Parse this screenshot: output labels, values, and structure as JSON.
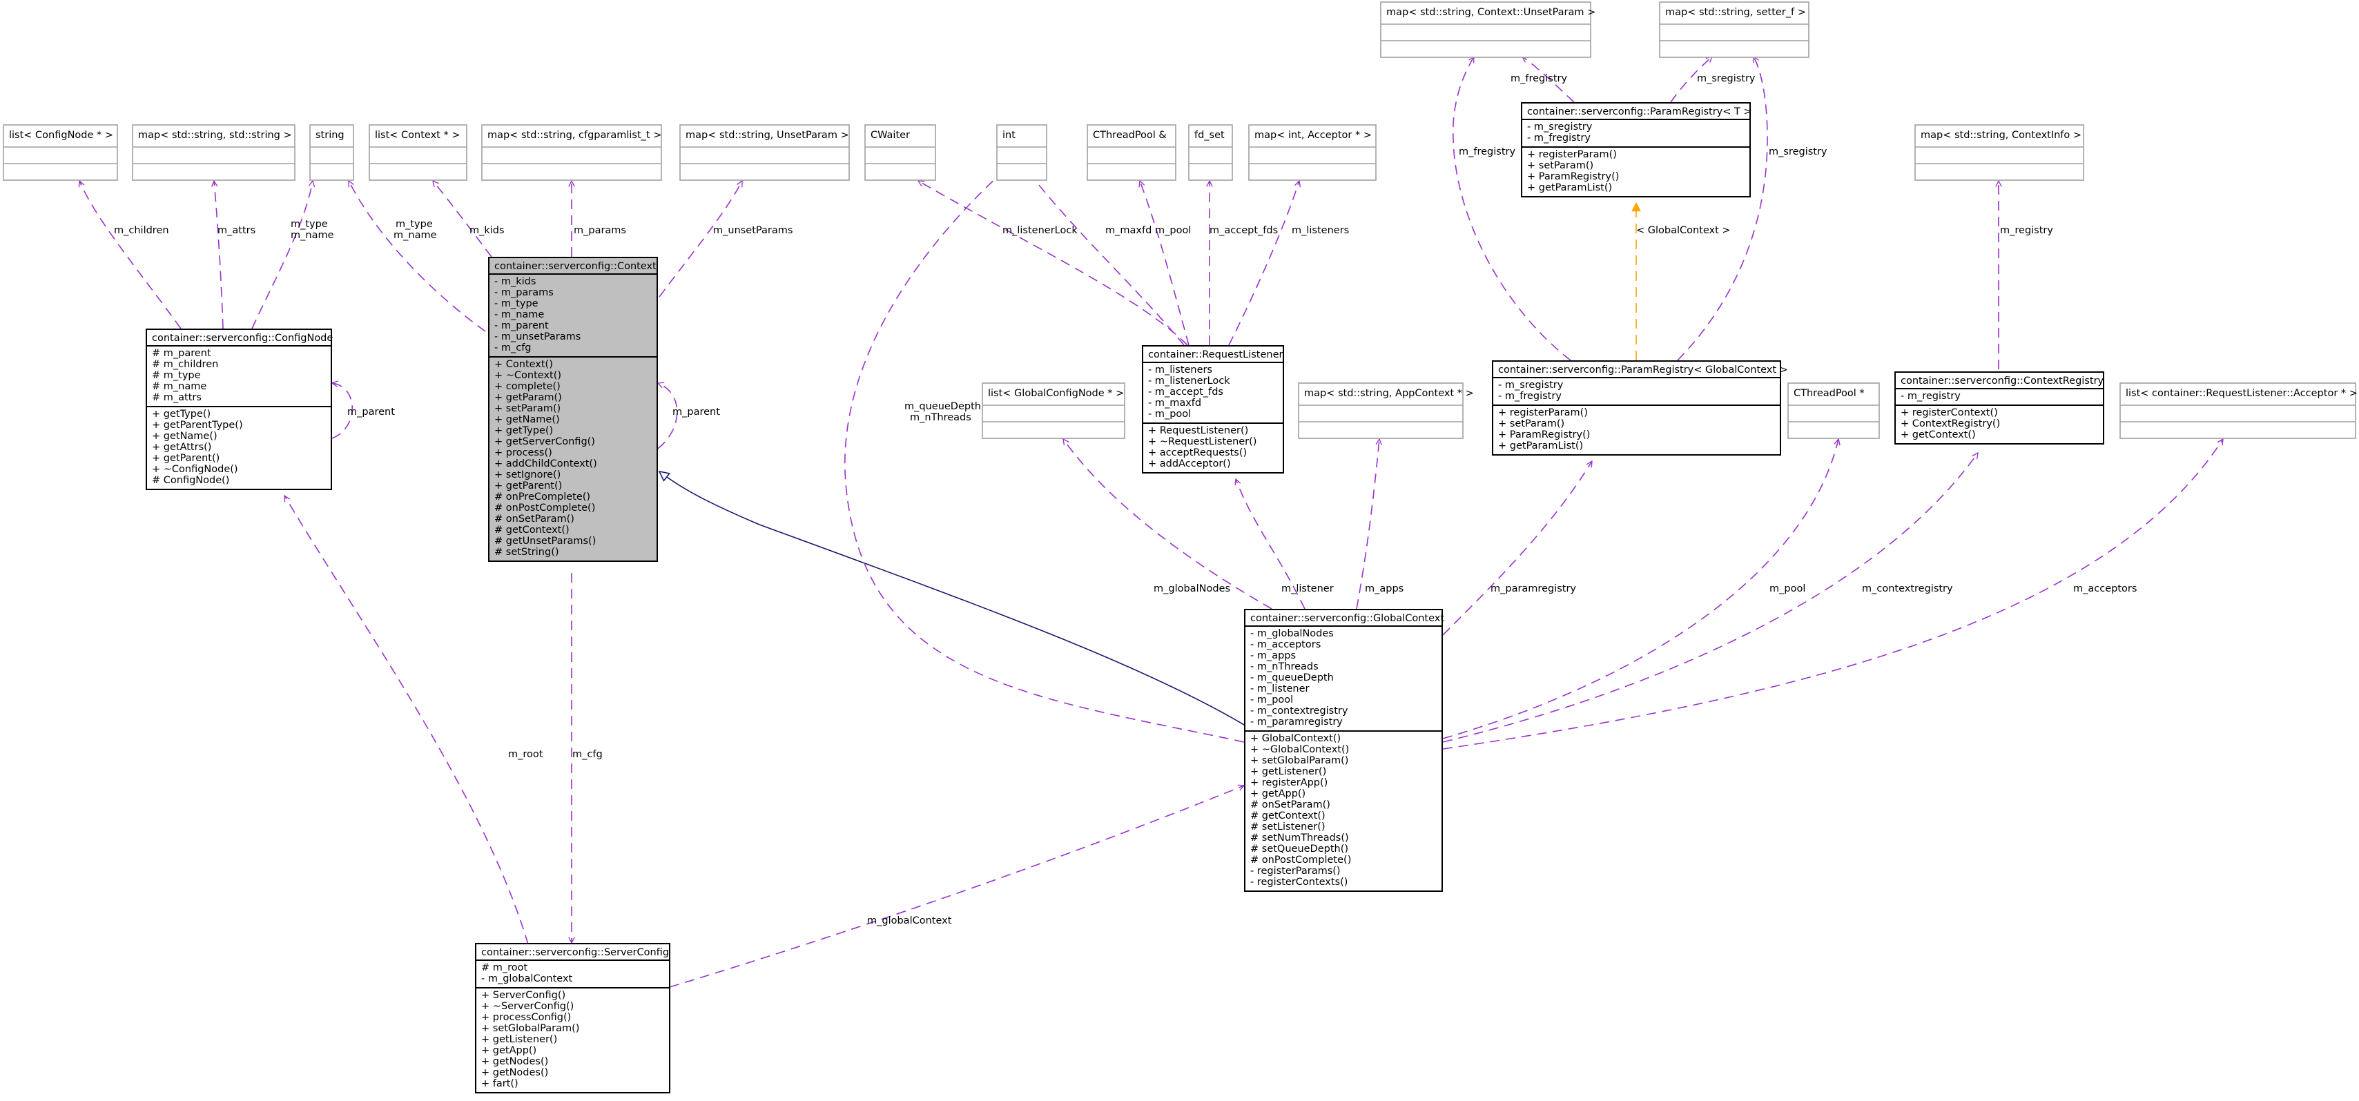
{
  "classes": {
    "context": {
      "name": "container::serverconfig::Context",
      "attrs": [
        "- m_kids",
        "- m_params",
        "- m_type",
        "- m_name",
        "- m_parent",
        "- m_unsetParams",
        "- m_cfg"
      ],
      "methods": [
        "+ Context()",
        "+ ~Context()",
        "+ complete()",
        "+ getParam()",
        "+ setParam()",
        "+ getName()",
        "+ getType()",
        "+ getServerConfig()",
        "+ process()",
        "+ addChildContext()",
        "+ setIgnore()",
        "+ getParent()",
        "# onPreComplete()",
        "# onPostComplete()",
        "# onSetParam()",
        "# getContext()",
        "# getUnsetParams()",
        "# setString()"
      ]
    },
    "confignode": {
      "name": "container::serverconfig::ConfigNode",
      "attrs": [
        "# m_parent",
        "# m_children",
        "# m_type",
        "# m_name",
        "# m_attrs"
      ],
      "methods": [
        "+ getType()",
        "+ getParentType()",
        "+ getName()",
        "+ getAttrs()",
        "+ getParent()",
        "+ ~ConfigNode()",
        "# ConfigNode()"
      ]
    },
    "requestlistener": {
      "name": "container::RequestListener",
      "attrs": [
        "- m_listeners",
        "- m_listenerLock",
        "- m_accept_fds",
        "- m_maxfd",
        "- m_pool"
      ],
      "methods": [
        "+ RequestListener()",
        "+ ~RequestListener()",
        "+ acceptRequests()",
        "+ addAcceptor()"
      ]
    },
    "paramregistry_t": {
      "name": "container::serverconfig::ParamRegistry< T >",
      "attrs": [
        "- m_sregistry",
        "- m_fregistry"
      ],
      "methods": [
        "+ registerParam()",
        "+ setParam()",
        "+ ParamRegistry()",
        "+ getParamList()"
      ]
    },
    "paramregistry_gc": {
      "name": "container::serverconfig::ParamRegistry< GlobalContext >",
      "attrs": [
        "- m_sregistry",
        "- m_fregistry"
      ],
      "methods": [
        "+ registerParam()",
        "+ setParam()",
        "+ ParamRegistry()",
        "+ getParamList()"
      ]
    },
    "contextregistry": {
      "name": "container::serverconfig::ContextRegistry",
      "attrs": [
        "- m_registry"
      ],
      "methods": [
        "+ registerContext()",
        "+ ContextRegistry()",
        "+ getContext()"
      ]
    },
    "globalcontext": {
      "name": "container::serverconfig::GlobalContext",
      "attrs": [
        "- m_globalNodes",
        "- m_acceptors",
        "- m_apps",
        "- m_nThreads",
        "- m_queueDepth",
        "- m_listener",
        "- m_pool",
        "- m_contextregistry",
        "- m_paramregistry"
      ],
      "methods": [
        "+ GlobalContext()",
        "+ ~GlobalContext()",
        "+ setGlobalParam()",
        "+ getListener()",
        "+ registerApp()",
        "+ getApp()",
        "# onSetParam()",
        "# getContext()",
        "# setListener()",
        "# setNumThreads()",
        "# setQueueDepth()",
        "# onPostComplete()",
        "- registerParams()",
        "- registerContexts()"
      ]
    },
    "serverconfig": {
      "name": "container::serverconfig::ServerConfig",
      "attrs": [
        "# m_root",
        "- m_globalContext"
      ],
      "methods": [
        "+ ServerConfig()",
        "+ ~ServerConfig()",
        "+ processConfig()",
        "+ setGlobalParam()",
        "+ getListener()",
        "+ getApp()",
        "+ getNodes()",
        "+ getNodes()",
        "+ fart()"
      ]
    }
  },
  "types": {
    "list_confignode": "list< ConfigNode * >",
    "map_string_string": "map< std::string, std::string >",
    "string": "string",
    "list_context": "list< Context * >",
    "map_cfgparamlist": "map< std::string, cfgparamlist_t >",
    "map_unsetparam": "map< std::string, UnsetParam >",
    "cwaiter": "CWaiter",
    "int": "int",
    "cthreadpool_ref": "CThreadPool &",
    "fd_set": "fd_set",
    "map_int_acceptor": "map< int, Acceptor * >",
    "map_ctx_unsetparam": "map< std::string, Context::UnsetParam >",
    "map_setter": "map< std::string, setter_f >",
    "map_contextinfo": "map< std::string, ContextInfo >",
    "list_globalconfignode": "list< GlobalConfigNode * >",
    "map_appcontext": "map< std::string, AppContext * >",
    "cthreadpool_ptr": "CThreadPool *",
    "list_acceptor": "list< container::RequestListener::Acceptor * >"
  },
  "edge_labels": {
    "m_children": "m_children",
    "m_attrs": "m_attrs",
    "cn_type": "m_type",
    "cn_name": "m_name",
    "ctx_type": "m_type",
    "ctx_name": "m_name",
    "m_kids": "m_kids",
    "m_params": "m_params",
    "m_unsetParams": "m_unsetParams",
    "cn_parent": "m_parent",
    "ctx_parent": "m_parent",
    "m_listenerLock": "m_listenerLock",
    "m_maxfd": "m_maxfd",
    "rl_pool": "m_pool",
    "m_accept_fds": "m_accept_fds",
    "m_listeners": "m_listeners",
    "pr_fregistry": "m_fregistry",
    "pr_sregistry": "m_sregistry",
    "gc_fregistry": "m_fregistry",
    "gc_sregistry": "m_sregistry",
    "tmpl_arg": "< GlobalContext >",
    "m_registry": "m_registry",
    "m_queueDepth": "m_queueDepth",
    "m_nThreads": "m_nThreads",
    "m_globalNodes": "m_globalNodes",
    "m_listener": "m_listener",
    "m_apps": "m_apps",
    "m_paramregistry": "m_paramregistry",
    "gc_pool": "m_pool",
    "m_contextregistry": "m_contextregistry",
    "m_acceptors": "m_acceptors",
    "m_root": "m_root",
    "m_cfg": "m_cfg",
    "m_globalContext": "m_globalContext"
  },
  "colors": {
    "usage_edge": "#9a32cd",
    "template_edge": "#ffa500",
    "inheritance_edge": "#191970",
    "highlighted_class": "#bfbfbf"
  }
}
